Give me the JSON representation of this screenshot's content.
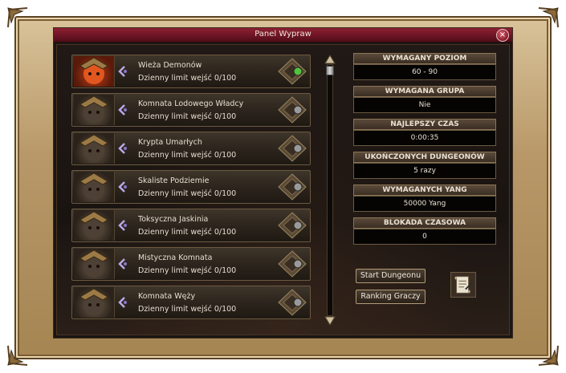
{
  "window": {
    "title": "Panel Wypraw",
    "close_label": "×"
  },
  "dungeons": [
    {
      "name": "Wieża Demonów",
      "limit": "Dzienny limit wejść 0/100",
      "selected": true
    },
    {
      "name": "Komnata Lodowego Władcy",
      "limit": "Dzienny limit wejść 0/100",
      "selected": false
    },
    {
      "name": "Krypta Umarłych",
      "limit": "Dzienny limit wejść 0/100",
      "selected": false
    },
    {
      "name": "Skaliste Podziemie",
      "limit": "Dzienny limit wejść 0/100",
      "selected": false
    },
    {
      "name": "Toksyczna Jaskinia",
      "limit": "Dzienny limit wejść 0/100",
      "selected": false
    },
    {
      "name": "Mistyczna Komnata",
      "limit": "Dzienny limit wejść 0/100",
      "selected": false
    },
    {
      "name": "Komnata Węży",
      "limit": "Dzienny limit wejść 0/100",
      "selected": false
    }
  ],
  "info": {
    "required_level_label": "WYMAGANY POZIOM",
    "required_level_value": "60 - 90",
    "required_group_label": "WYMAGANA GRUPA",
    "required_group_value": "Nie",
    "best_time_label": "NAJLEPSZY CZAS",
    "best_time_value": "0:00:35",
    "completed_label": "UKOŃCZONYCH DUNGEONÓW",
    "completed_value": "5 razy",
    "required_yang_label": "WYMAGANYCH YANG",
    "required_yang_value": "50000 Yang",
    "time_block_label": "BLOKADA CZASOWA",
    "time_block_value": "0"
  },
  "buttons": {
    "start": "Start Dungeonu",
    "ranking": "Ranking Graczy"
  },
  "colors": {
    "title_bar": "#6b1424",
    "text": "#e6ddd0",
    "border_gold": "#b39b77",
    "active_dot": "#4fc63a"
  },
  "icons": {
    "close": "close-icon",
    "rune": "rune-icon",
    "emblem": "dungeon-emblem-icon",
    "scroll_up": "arrow-up-icon",
    "scroll_down": "arrow-down-icon",
    "scroll_item": "scroll-item-icon"
  }
}
